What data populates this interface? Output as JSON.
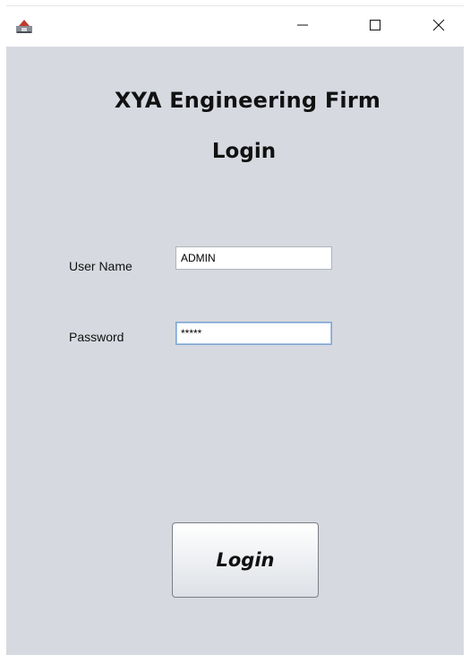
{
  "window": {
    "icon": "java-app-icon",
    "minimize_icon": "minimize-icon",
    "maximize_icon": "maximize-icon",
    "close_icon": "close-icon"
  },
  "header": {
    "company": "XYA Engineering Firm",
    "subtitle": "Login"
  },
  "form": {
    "username_label": "User Name",
    "username_value": "ADMIN",
    "password_label": "Password",
    "password_value": "*****"
  },
  "actions": {
    "login_label": "Login"
  },
  "colors": {
    "client_background": "#d6d9e0",
    "field_focus_border": "#7ea4cf"
  }
}
